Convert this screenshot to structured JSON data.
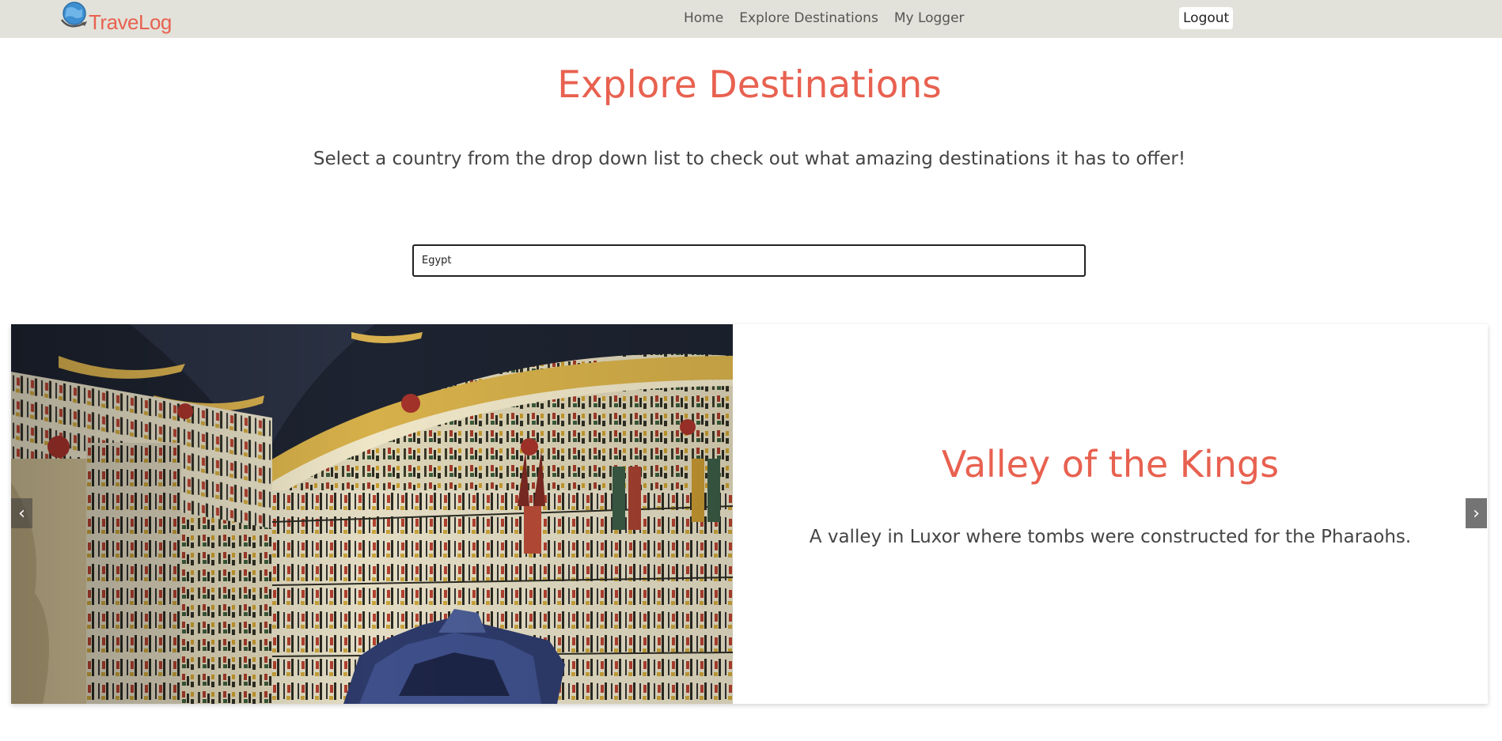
{
  "app": {
    "logo_text": "TraveLog",
    "brand_color": "#e86150"
  },
  "nav": {
    "items": [
      {
        "label": "Home"
      },
      {
        "label": "Explore Destinations"
      },
      {
        "label": "My Logger"
      }
    ],
    "logout_label": "Logout"
  },
  "page": {
    "title": "Explore Destinations",
    "subtitle": "Select a country from the drop down list to check out what amazing destinations it has to offer!"
  },
  "country_select": {
    "value": "Egypt"
  },
  "destination": {
    "name": "Valley of the Kings",
    "description": "A valley in Luxor where tombs were constructed for the Pharaohs.",
    "image_icon": "tomb-hieroglyphs-photo"
  },
  "carousel": {
    "prev_icon": "‹",
    "next_icon": "›"
  }
}
